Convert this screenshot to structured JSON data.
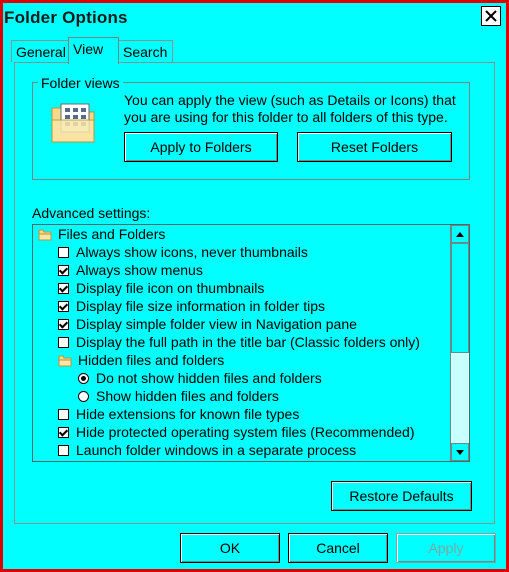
{
  "window": {
    "title": "Folder Options"
  },
  "tabs": [
    {
      "label": "General"
    },
    {
      "label": "View"
    },
    {
      "label": "Search"
    }
  ],
  "folder_views": {
    "legend": "Folder views",
    "description": "You can apply the view (such as Details or Icons) that you are using for this folder to all folders of this type.",
    "apply_button": "Apply to Folders",
    "reset_button": "Reset Folders"
  },
  "advanced": {
    "label": "Advanced settings:",
    "items": [
      {
        "type": "folder",
        "label": "Files and Folders"
      },
      {
        "type": "checkbox",
        "checked": false,
        "label": "Always show icons, never thumbnails"
      },
      {
        "type": "checkbox",
        "checked": true,
        "label": "Always show menus"
      },
      {
        "type": "checkbox",
        "checked": true,
        "label": "Display file icon on thumbnails"
      },
      {
        "type": "checkbox",
        "checked": true,
        "label": "Display file size information in folder tips"
      },
      {
        "type": "checkbox",
        "checked": true,
        "label": "Display simple folder view in Navigation pane"
      },
      {
        "type": "checkbox",
        "checked": false,
        "label": "Display the full path in the title bar (Classic folders only)"
      },
      {
        "type": "folder",
        "label": "Hidden files and folders"
      },
      {
        "type": "radio",
        "checked": true,
        "label": "Do not show hidden files and folders"
      },
      {
        "type": "radio",
        "checked": false,
        "label": "Show hidden files and folders"
      },
      {
        "type": "checkbox",
        "checked": false,
        "label": "Hide extensions for known file types"
      },
      {
        "type": "checkbox",
        "checked": true,
        "label": "Hide protected operating system files (Recommended)"
      },
      {
        "type": "checkbox",
        "checked": false,
        "label": "Launch folder windows in a separate process"
      }
    ]
  },
  "restore_button": "Restore Defaults",
  "footer": {
    "ok": "OK",
    "cancel": "Cancel",
    "apply": "Apply"
  },
  "colors": {
    "background": "#00FFFF",
    "window_border": "#E00000"
  }
}
